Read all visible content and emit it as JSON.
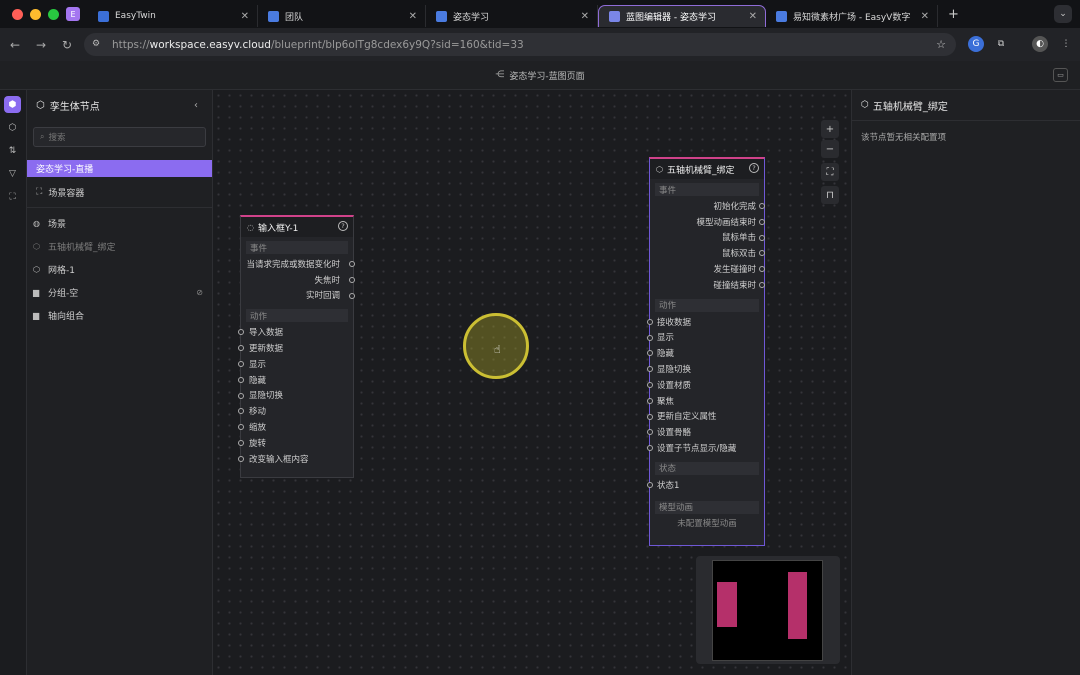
{
  "browser": {
    "tabs": [
      {
        "label": "EasyTwin",
        "active": false
      },
      {
        "label": "团队",
        "active": false
      },
      {
        "label": "姿态学习",
        "active": false
      },
      {
        "label": "蓝图编辑器 - 姿态学习",
        "active": true
      },
      {
        "label": "易知微素材广场 - EasyV数字",
        "active": false
      }
    ],
    "url_prefix": "https://",
    "url_host": "workspace.easyv.cloud",
    "url_path": "/blueprint/blp6olTg8cdex6y9Q?sid=160&tid=33"
  },
  "header": {
    "title": "姿态学习-蓝图页面"
  },
  "left_panel": {
    "title": "孪生体节点",
    "search_placeholder": "搜索",
    "active_scene": "姿态学习-直播",
    "scene_container": "场景容器",
    "tree": [
      {
        "label": "场景",
        "icon": "globe-icon",
        "dim": false
      },
      {
        "label": "五轴机械臂_绑定",
        "icon": "cube-icon",
        "dim": true
      },
      {
        "label": "网格-1",
        "icon": "cube-icon",
        "dim": false
      },
      {
        "label": "分组-空",
        "icon": "folder-icon",
        "dim": false,
        "hidden": true
      },
      {
        "label": "轴向组合",
        "icon": "folder-icon",
        "dim": false
      }
    ]
  },
  "node_input": {
    "title": "输入框Y-1",
    "events_label": "事件",
    "events": [
      "当请求完成或数据变化时",
      "失焦时",
      "实时回调"
    ],
    "actions_label": "动作",
    "actions": [
      "导入数据",
      "更新数据",
      "显示",
      "隐藏",
      "显隐切换",
      "移动",
      "缩放",
      "旋转",
      "改变输入框内容"
    ]
  },
  "node_arm": {
    "title": "五轴机械臂_绑定",
    "events_label": "事件",
    "events": [
      "初始化完成",
      "模型动画结束时",
      "鼠标单击",
      "鼠标双击",
      "发生碰撞时",
      "碰撞结束时"
    ],
    "actions_label": "动作",
    "actions": [
      "接收数据",
      "显示",
      "隐藏",
      "显隐切换",
      "设置材质",
      "聚焦",
      "更新自定义属性",
      "设置骨骼",
      "设置子节点显示/隐藏"
    ],
    "state_label": "状态",
    "states": [
      "状态1"
    ],
    "anim_label": "模型动画",
    "anim_empty": "未配置模型动画"
  },
  "right_panel": {
    "title": "五轴机械臂_绑定",
    "note": "该节点暂无相关配置项"
  },
  "colors": {
    "accent": "#8b6cf0",
    "node_header_bar": "#d0428a",
    "minimap_block": "#b5306a"
  }
}
